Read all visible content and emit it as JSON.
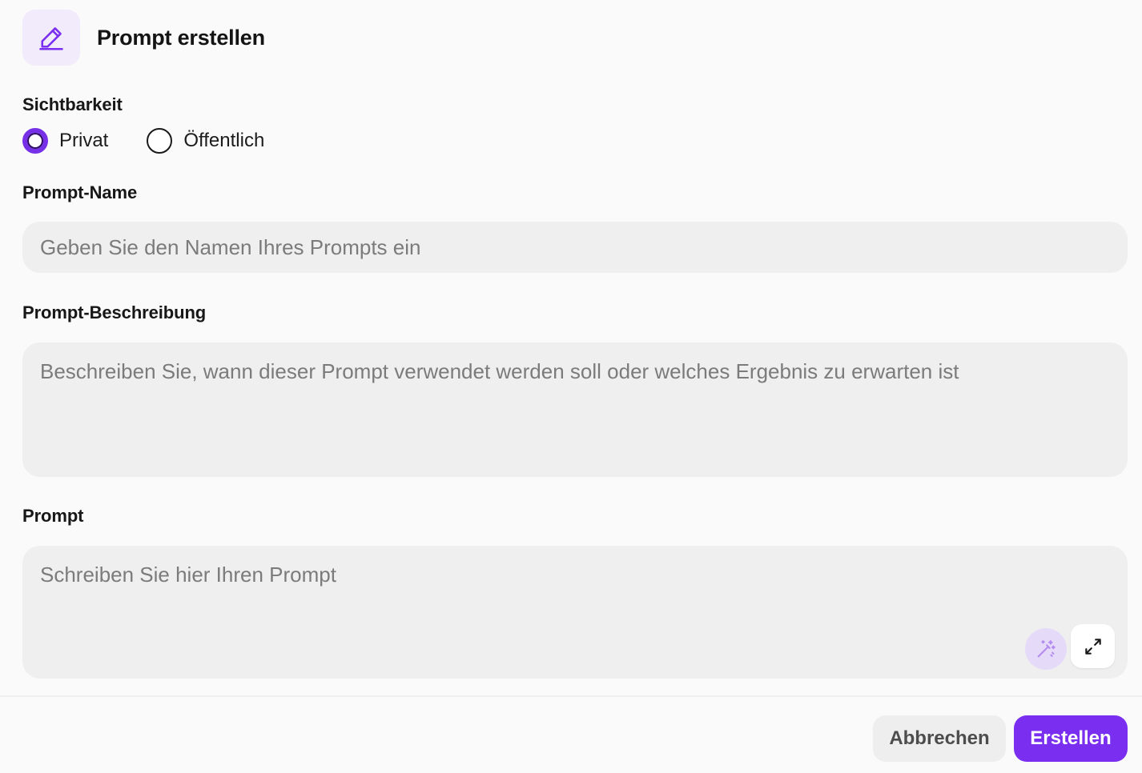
{
  "dialog": {
    "title": "Prompt erstellen",
    "icon": "pencil-icon"
  },
  "visibility": {
    "label": "Sichtbarkeit",
    "options": [
      {
        "label": "Privat",
        "selected": true
      },
      {
        "label": "Öffentlich",
        "selected": false
      }
    ]
  },
  "name_field": {
    "label": "Prompt-Name",
    "value": "",
    "placeholder": "Geben Sie den Namen Ihres Prompts ein"
  },
  "description_field": {
    "label": "Prompt-Beschreibung",
    "value": "",
    "placeholder": "Beschreiben Sie, wann dieser Prompt verwendet werden soll oder welches Ergebnis zu erwarten ist"
  },
  "prompt_field": {
    "label": "Prompt",
    "value": "",
    "placeholder": "Schreiben Sie hier Ihren Prompt",
    "tools": [
      "magic-wand-icon",
      "expand-icon"
    ]
  },
  "footer": {
    "cancel_label": "Abbrechen",
    "create_label": "Erstellen"
  },
  "colors": {
    "accent": "#7a2ff0",
    "icon_bg": "#f1ebfb",
    "field_bg": "#efefef"
  }
}
